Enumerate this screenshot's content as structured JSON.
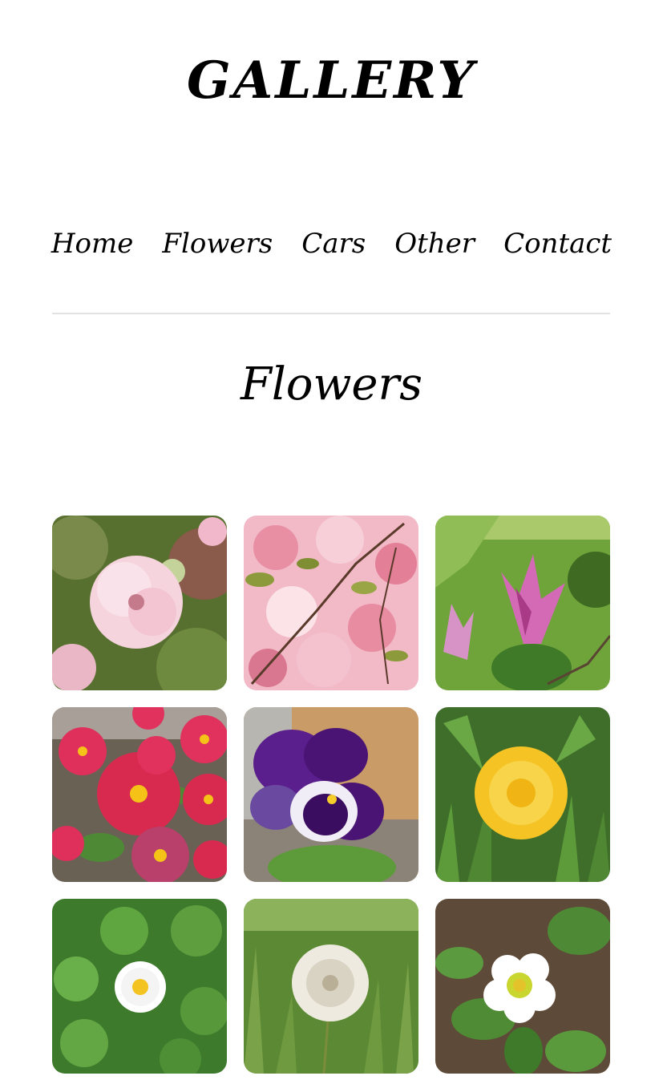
{
  "site": {
    "title": "GALLERY"
  },
  "nav": {
    "items": [
      {
        "label": "Home"
      },
      {
        "label": "Flowers"
      },
      {
        "label": "Cars"
      },
      {
        "label": "Other"
      },
      {
        "label": "Contact"
      }
    ]
  },
  "page": {
    "heading": "Flowers"
  },
  "gallery": {
    "images": [
      {
        "subject": "pink double cherry blossom close-up",
        "colors": {
          "bg": "#5f7a3c",
          "accent": "#f4c9d6"
        }
      },
      {
        "subject": "pink cherry blossom branches",
        "colors": {
          "bg": "#f1b6c4",
          "accent": "#7c8f3a"
        }
      },
      {
        "subject": "pink magnolia on lawn",
        "colors": {
          "bg": "#6fa53a",
          "accent": "#d46ab6"
        }
      },
      {
        "subject": "red bellis daisies",
        "colors": {
          "bg": "#6b6258",
          "accent": "#d8294e"
        }
      },
      {
        "subject": "purple pansy",
        "colors": {
          "bg": "#c89b66",
          "accent": "#4a1474"
        }
      },
      {
        "subject": "yellow dandelion in grass",
        "colors": {
          "bg": "#3f6e2a",
          "accent": "#f6c325"
        }
      },
      {
        "subject": "white daisy among clover",
        "colors": {
          "bg": "#3d7a2c",
          "accent": "#ffffff"
        }
      },
      {
        "subject": "dandelion seed head",
        "colors": {
          "bg": "#5c8a34",
          "accent": "#eeeae0"
        }
      },
      {
        "subject": "white strawberry flower",
        "colors": {
          "bg": "#5e4a38",
          "accent": "#ffffff"
        }
      }
    ]
  }
}
